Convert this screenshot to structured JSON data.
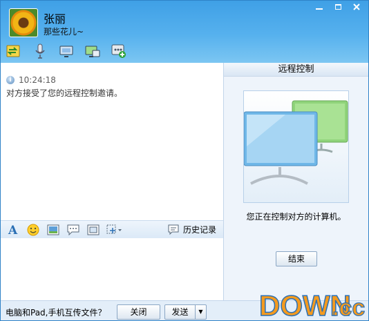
{
  "contact": {
    "name": "张丽",
    "signature": "那些花儿~"
  },
  "toolbar_top": [
    {
      "icon": "file-transfer-icon"
    },
    {
      "icon": "microphone-icon"
    },
    {
      "icon": "remote-desktop-icon"
    },
    {
      "icon": "screen-share-icon"
    },
    {
      "icon": "more-apps-icon"
    }
  ],
  "chat": {
    "messages": [
      {
        "time": "10:24:18",
        "text": "对方接受了您的远程控制邀请。"
      }
    ]
  },
  "format_toolbar": {
    "icons": [
      "font-icon",
      "emoji-icon",
      "image-icon",
      "chat-bubble-icon",
      "screenshot-icon",
      "capture-dropdown-icon"
    ],
    "history_label": "历史记录"
  },
  "remote_panel": {
    "title": "远程控制",
    "status": "您正在控制对方的计算机。",
    "end_label": "结束"
  },
  "bottom": {
    "transfer_text": "电脑和Pad,手机互传文件？",
    "close_label": "关闭",
    "send_label": "发送",
    "send_arrow": "▼"
  },
  "watermark": {
    "text_main": "DOWN",
    "text_tld": ".cc"
  },
  "colors": {
    "header_blue": "#3fa0e6",
    "panel_bg": "#eef4fb",
    "watermark_orange": "#f39a1f",
    "watermark_blue": "#2a6fb4"
  }
}
